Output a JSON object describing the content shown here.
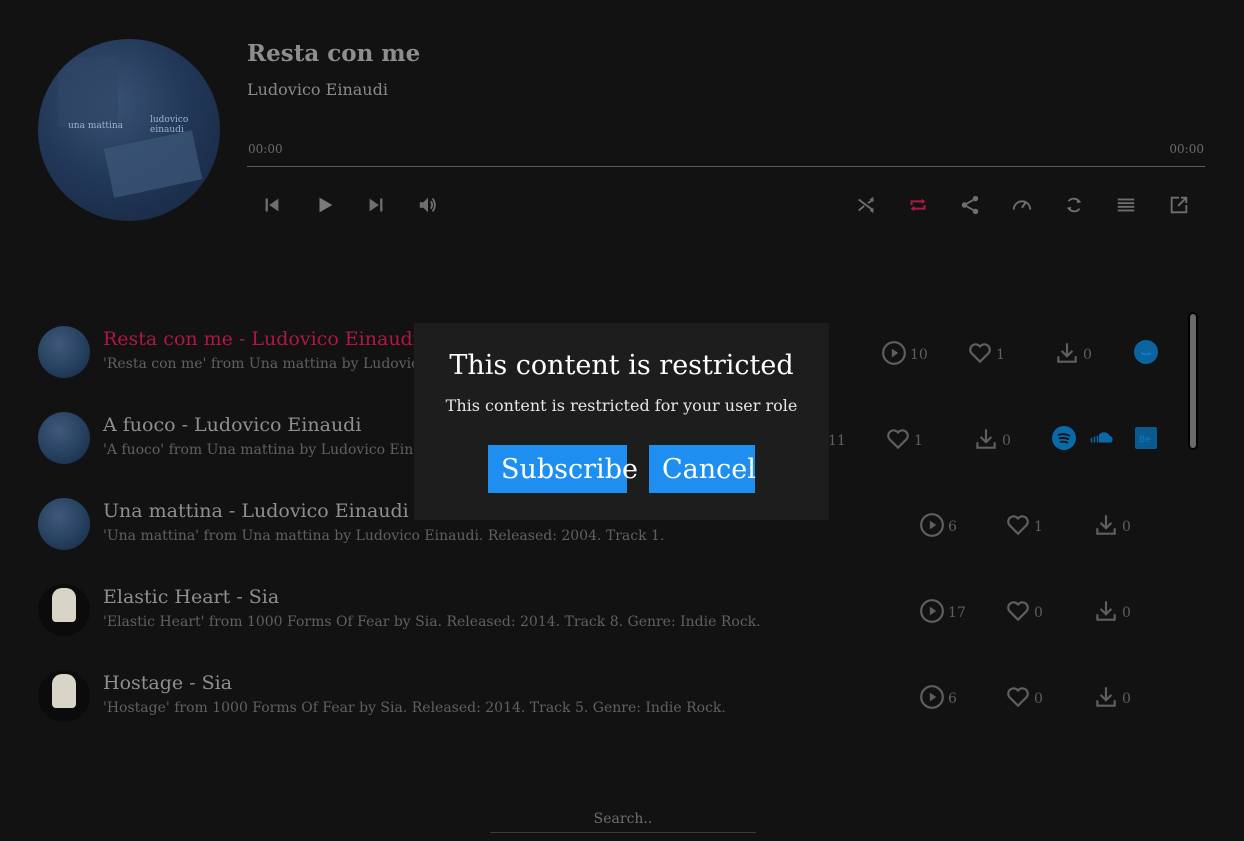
{
  "now_playing": {
    "title": "Resta con me",
    "artist": "Ludovico Einaudi",
    "time_current": "00:00",
    "time_total": "00:00",
    "progress": 0,
    "cover_text_left": "una mattina",
    "cover_text_right": "ludovico einaudi"
  },
  "controls": {
    "left": [
      "previous-icon",
      "play-icon",
      "next-icon",
      "volume-icon"
    ],
    "right": [
      "shuffle-icon",
      "repeat-icon",
      "share-icon",
      "speed-icon",
      "refresh-icon",
      "playlist-icon",
      "popout-icon"
    ],
    "accent_color": "#b01843"
  },
  "tracks": [
    {
      "title": "Resta con me - Ludovico Einaudi",
      "desc": "'Resta con me' from Una mattina by Ludovico Einaudi.",
      "plays": "10",
      "likes": "1",
      "downloads": "0",
      "active": true,
      "cover": "einaudi",
      "services": [
        "amazon"
      ]
    },
    {
      "title": "A fuoco - Ludovico Einaudi",
      "desc": "'A fuoco' from Una mattina by Ludovico Einaudi.",
      "plays": "11",
      "likes": "1",
      "downloads": "0",
      "active": false,
      "cover": "einaudi",
      "services": [
        "spotify",
        "soundcloud",
        "beatport"
      ]
    },
    {
      "title": "Una mattina - Ludovico Einaudi",
      "desc": "'Una mattina' from Una mattina by Ludovico Einaudi. Released: 2004. Track 1.",
      "plays": "6",
      "likes": "1",
      "downloads": "0",
      "active": false,
      "cover": "einaudi",
      "services": []
    },
    {
      "title": "Elastic Heart - Sia",
      "desc": "'Elastic Heart' from 1000 Forms Of Fear by Sia. Released: 2014. Track 8. Genre: Indie Rock.",
      "plays": "17",
      "likes": "0",
      "downloads": "0",
      "active": false,
      "cover": "sia",
      "services": []
    },
    {
      "title": "Hostage - Sia",
      "desc": "'Hostage' from 1000 Forms Of Fear by Sia. Released: 2014. Track 5. Genre: Indie Rock.",
      "plays": "6",
      "likes": "0",
      "downloads": "0",
      "active": false,
      "cover": "sia",
      "services": []
    }
  ],
  "search": {
    "placeholder": "Search.."
  },
  "modal": {
    "title": "This content is restricted",
    "text": "This content is restricted for your user role",
    "subscribe_label": "Subscribe",
    "cancel_label": "Cancel",
    "button_color": "#1e8ff1"
  }
}
